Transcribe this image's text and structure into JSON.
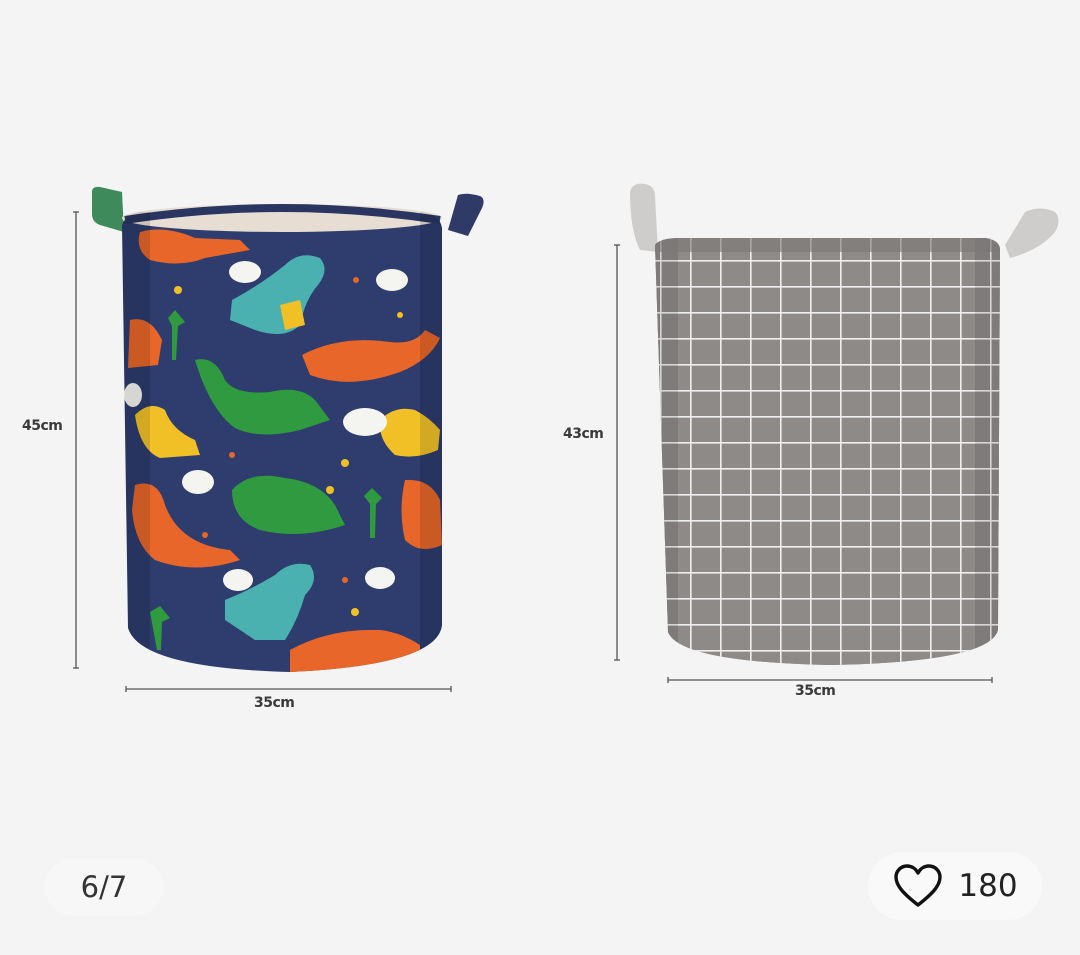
{
  "gallery": {
    "counter": "6/7",
    "like_count": "180",
    "like_icon": "heart-icon"
  },
  "products": [
    {
      "name": "dinosaur-print-basket",
      "height_label": "45cm",
      "width_label": "35cm"
    },
    {
      "name": "grey-grid-basket",
      "height_label": "43cm",
      "width_label": "35cm"
    }
  ],
  "colors": {
    "background": "#f4f4f4",
    "dino_basket_body": "#2e3c6e",
    "grid_basket_body": "#8c8886",
    "handle_grey": "#c9c7c5"
  }
}
